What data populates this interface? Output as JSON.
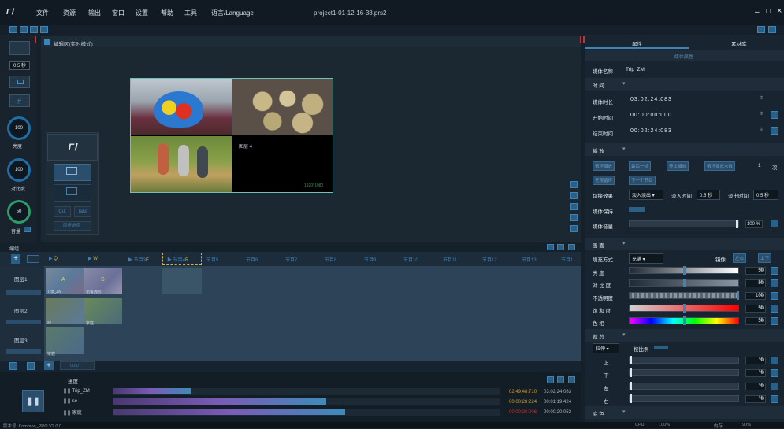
{
  "app": {
    "title": "project1-01-12-16-38.prs2"
  },
  "menu": [
    "文件",
    "资源",
    "输出",
    "窗口",
    "设置",
    "帮助",
    "工具",
    "语言/Language"
  ],
  "window_controls": [
    "–",
    "□",
    "×"
  ],
  "left_panel": {
    "duration": "0.5 秒",
    "brightness_value": "100",
    "brightness_label": "亮度",
    "contrast_value": "100",
    "contrast_label": "对比度",
    "volume_value": "50",
    "volume_label": "音量"
  },
  "edit_area": {
    "title": "编辑区(实时模式)",
    "cut": "Cut",
    "take": "Take",
    "sync_option": "同步选项",
    "cell4_label": "图层 4",
    "resolution": "1920*1080"
  },
  "timeline": {
    "header": "编组",
    "markers": [
      "Q",
      "W",
      "E",
      "R",
      "节目5",
      "节目6",
      "节目7",
      "节目8",
      "节目9",
      "节目10",
      "节目11",
      "节目12",
      "节目13",
      "节目1"
    ],
    "marker_prefix": [
      "",
      "",
      "节目3",
      "节目4"
    ],
    "layers": [
      "图层1",
      "图层2",
      "图层3"
    ],
    "clip_names": [
      "Trip_ZM",
      "布鲁西珍",
      "se",
      "家庭",
      "家庭"
    ],
    "clip_keys": [
      "A",
      "S"
    ],
    "play_label": "00:0"
  },
  "progress": {
    "header": "进度",
    "rows": [
      {
        "name": "Trip_ZM",
        "fill": 0.2,
        "elapsed": "02:49:48:710",
        "total": "03:02:24:083"
      },
      {
        "name": "se",
        "fill": 0.55,
        "elapsed": "00:00:28:224",
        "total": "00:01:19:424"
      },
      {
        "name": "家庭",
        "fill": 0.6,
        "elapsed": "00:00:20:006",
        "total": "00:00:20:053"
      }
    ]
  },
  "status": {
    "version": "版本号: Kommon_PRO V2.0.0",
    "cpu": "CPU:",
    "cpu_val": "100%",
    "mem": "内存:",
    "mem_val": "90%"
  },
  "right_panel": {
    "tabs": [
      "属性",
      "素材库"
    ],
    "subtitle": "媒体属性",
    "media_name_label": "媒体名称",
    "media_name": "Trip_ZM",
    "time_section": "时 间",
    "duration_label": "媒体时长",
    "duration": "03:02:24:083",
    "start_label": "开始时间",
    "start": "00:00:00:000",
    "end_label": "结束时间",
    "end": "00:02:24:083",
    "play_section": "播 放",
    "play_opts": [
      "循环播放",
      "最后一帧",
      "停止播放",
      "循环播放次数"
    ],
    "loop_count": "1",
    "loop_unit": "次",
    "play_opts2": [
      "无限循环",
      "下一个节目"
    ],
    "switch_label": "切换效果",
    "switch_value": "淡入淡出",
    "fadein_label": "淡入时间",
    "fadein": "0.5",
    "fadeout_label": "淡出时间",
    "fadeout": "0.5",
    "sec": "秒",
    "keep_label": "媒体保持",
    "volume_label": "媒体音量",
    "volume": "100",
    "picture_section": "画 面",
    "fill_label": "填充方式",
    "fill_value": "充满",
    "mirror_label": "镜像",
    "mirror_opts": [
      "左右",
      "上下"
    ],
    "sliders": [
      {
        "label": "亮 度",
        "value": "50",
        "pos": 0.5
      },
      {
        "label": "对 比 度",
        "value": "50",
        "pos": 0.5
      },
      {
        "label": "不透明度",
        "value": "100",
        "pos": 1.0
      },
      {
        "label": "饱 和 度",
        "value": "50",
        "pos": 0.5
      },
      {
        "label": "色 相",
        "value": "50",
        "pos": 0.5
      }
    ],
    "crop_section": "裁 剪",
    "crop_mode": "拉伸",
    "crop_ratio_label": "按比例",
    "crops": [
      {
        "label": "上",
        "value": "0"
      },
      {
        "label": "下",
        "value": "0"
      },
      {
        "label": "左",
        "value": "0"
      },
      {
        "label": "右",
        "value": "0"
      }
    ],
    "color_section": "底 色",
    "percent": "%"
  }
}
